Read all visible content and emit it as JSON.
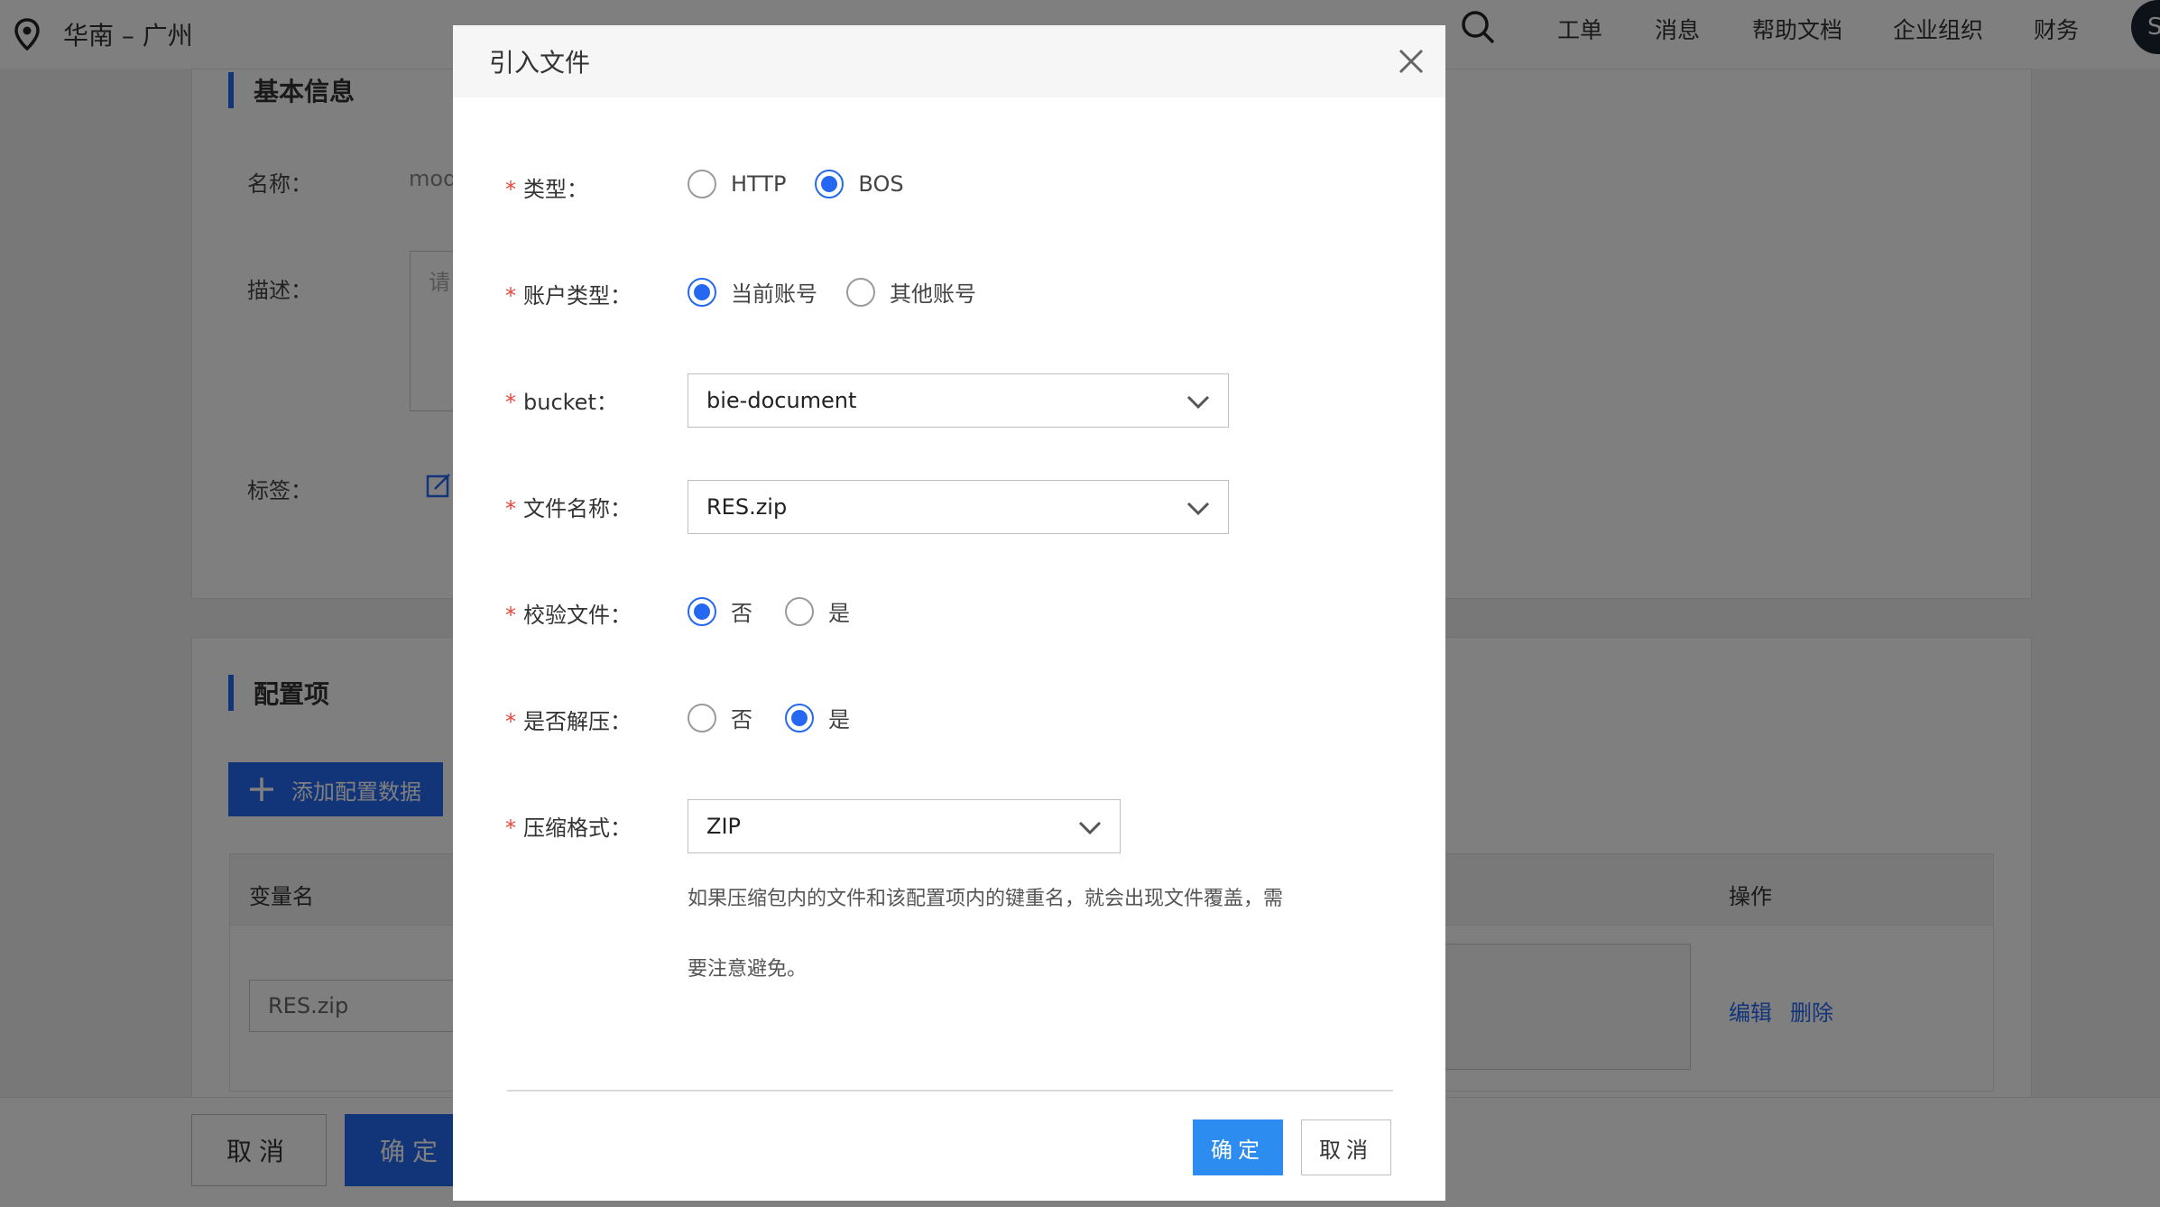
{
  "topbar": {
    "region": "华南 – 广州",
    "nav": [
      "工单",
      "消息",
      "帮助文档",
      "企业组织",
      "财务"
    ],
    "avatar_initial": "S"
  },
  "basic_info": {
    "title": "基本信息",
    "name_label": "名称：",
    "name_value": "mod",
    "desc_label": "描述：",
    "desc_placeholder": "请",
    "tag_label": "标签："
  },
  "config": {
    "title": "配置项",
    "add_button": "添加配置数据",
    "col_var": "变量名",
    "col_action": "操作",
    "row_value": "RES.zip",
    "edit": "编辑",
    "delete": "删除"
  },
  "page_footer": {
    "cancel": "取消",
    "confirm": "确定"
  },
  "modal": {
    "title": "引入文件",
    "type": {
      "label": "类型：",
      "options": [
        "HTTP",
        "BOS"
      ],
      "selected": "BOS"
    },
    "account": {
      "label": "账户类型：",
      "options": [
        "当前账号",
        "其他账号"
      ],
      "selected": "当前账号"
    },
    "bucket": {
      "label": "bucket：",
      "value": "bie-document"
    },
    "filename": {
      "label": "文件名称：",
      "value": "RES.zip"
    },
    "verify": {
      "label": "校验文件：",
      "options": [
        "否",
        "是"
      ],
      "selected": "否"
    },
    "unzip": {
      "label": "是否解压：",
      "options": [
        "否",
        "是"
      ],
      "selected": "是"
    },
    "format": {
      "label": "压缩格式：",
      "value": "ZIP"
    },
    "hint_line1": "如果压缩包内的文件和该配置项内的键重名，就会出现文件覆盖，需",
    "hint_line2": "要注意避免。",
    "ok": "确定",
    "cancel": "取消"
  },
  "colors": {
    "primary": "#2468f2",
    "button": "#2d8cf0",
    "required": "#e8473c"
  }
}
